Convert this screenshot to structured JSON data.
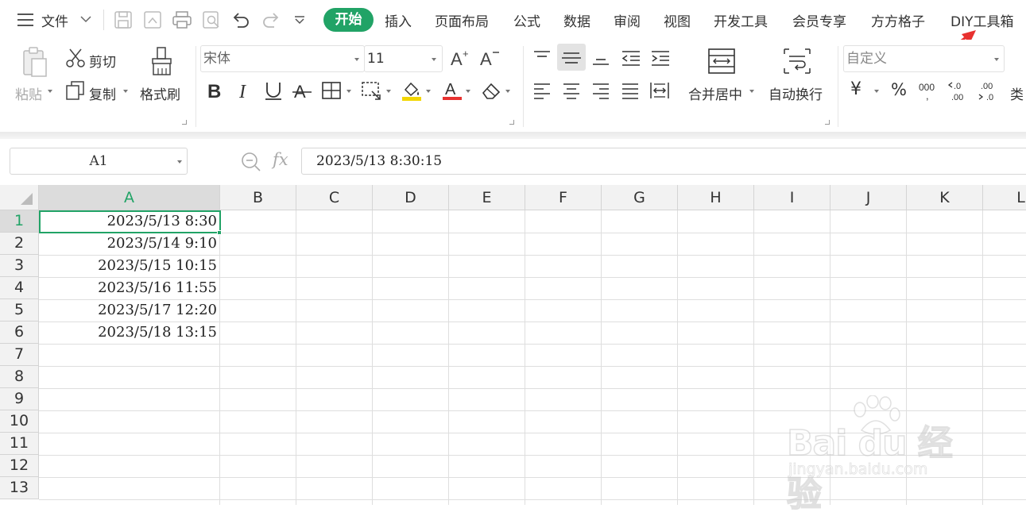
{
  "menubar": {
    "file_label": "文件",
    "tabs": [
      "开始",
      "插入",
      "页面布局",
      "公式",
      "数据",
      "审阅",
      "视图",
      "开发工具",
      "会员专享",
      "方方格子",
      "DIY工具箱"
    ],
    "active_tab": "开始",
    "accent_color": "#21a366",
    "annotation_arrow_color": "#e8312f"
  },
  "ribbon": {
    "clipboard": {
      "paste_label": "粘贴",
      "cut_label": "剪切",
      "copy_label": "复制",
      "format_painter_label": "格式刷"
    },
    "font": {
      "font_name": "宋体",
      "font_size": "11"
    },
    "alignment": {
      "merge_center_label": "合并居中",
      "wrap_text_label": "自动换行"
    },
    "number": {
      "format": "自定义",
      "currency_symbol": "¥",
      "percent_symbol": "%",
      "more_label": "类"
    },
    "icons": {
      "font_color": "#e8312f",
      "fill_color": "#f2d600"
    }
  },
  "formula_bar": {
    "cell_ref": "A1",
    "fx_label": "fx",
    "value": "2023/5/13  8:30:15"
  },
  "sheet": {
    "columns": [
      "A",
      "B",
      "C",
      "D",
      "E",
      "F",
      "G",
      "H",
      "I",
      "J",
      "K",
      "L"
    ],
    "rows": [
      "1",
      "2",
      "3",
      "4",
      "5",
      "6",
      "7",
      "8",
      "9",
      "10",
      "11",
      "12",
      "13"
    ],
    "active_cell": "A1",
    "cells_A": [
      "2023/5/13  8:30",
      "2023/5/14  9:10",
      "2023/5/15  10:15",
      "2023/5/16  11:55",
      "2023/5/17  12:20",
      "2023/5/18  13:15"
    ]
  },
  "watermark": {
    "brand": "Bai du 经验",
    "url": "jingyan.baidu.com"
  }
}
